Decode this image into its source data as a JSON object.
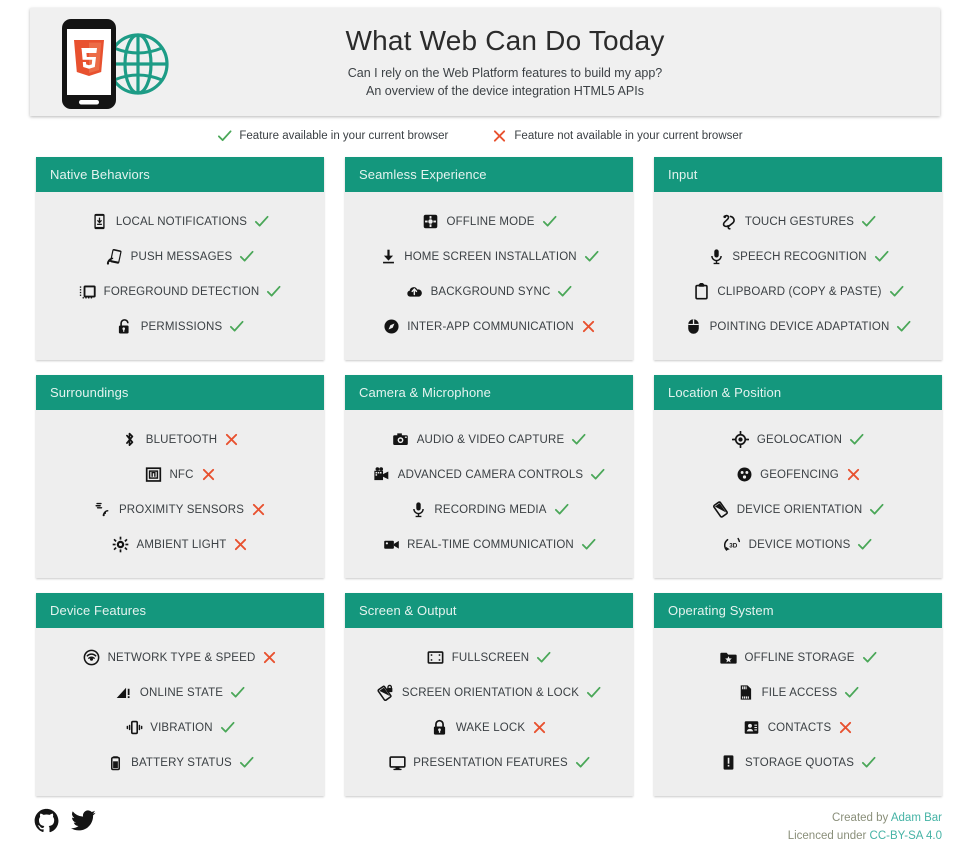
{
  "header": {
    "title": "What Web Can Do Today",
    "subtitle_line1": "Can I rely on the Web Platform features to build my app?",
    "subtitle_line2": "An overview of the device integration HTML5 APIs",
    "logo_icon": "html5-phone-globe-logo"
  },
  "legend": {
    "available_label": "Feature available in your current browser",
    "unavailable_label": "Feature not available in your current browser",
    "available_icon": "check-icon",
    "unavailable_icon": "cross-icon"
  },
  "colors": {
    "card_header_bg": "#14977d",
    "card_body_bg": "#eeeeee",
    "page_bg": "#ffffff",
    "check_green": "#4aa758",
    "cross_red": "#e8512f",
    "link_teal": "#45b3a5",
    "footer_text": "#8a8f7a"
  },
  "cards": [
    {
      "title": "Native Behaviors",
      "features": [
        {
          "label": "LOCAL NOTIFICATIONS",
          "icon": "phone-download-icon",
          "status": "available"
        },
        {
          "label": "PUSH MESSAGES",
          "icon": "phone-signal-icon",
          "status": "available"
        },
        {
          "label": "FOREGROUND DETECTION",
          "icon": "foreground-window-icon",
          "status": "available"
        },
        {
          "label": "PERMISSIONS",
          "icon": "padlock-open-icon",
          "status": "available"
        }
      ]
    },
    {
      "title": "Seamless Experience",
      "features": [
        {
          "label": "OFFLINE MODE",
          "icon": "offline-gear-icon",
          "status": "available"
        },
        {
          "label": "HOME SCREEN INSTALLATION",
          "icon": "download-arrow-icon",
          "status": "available"
        },
        {
          "label": "BACKGROUND SYNC",
          "icon": "cloud-upload-icon",
          "status": "available"
        },
        {
          "label": "INTER-APP COMMUNICATION",
          "icon": "compass-icon",
          "status": "unavailable"
        }
      ]
    },
    {
      "title": "Input",
      "features": [
        {
          "label": "TOUCH GESTURES",
          "icon": "touch-gesture-icon",
          "status": "available"
        },
        {
          "label": "SPEECH RECOGNITION",
          "icon": "microphone-icon",
          "status": "available"
        },
        {
          "label": "CLIPBOARD (COPY & PASTE)",
          "icon": "clipboard-icon",
          "status": "available"
        },
        {
          "label": "POINTING DEVICE ADAPTATION",
          "icon": "mouse-icon",
          "status": "available"
        }
      ]
    },
    {
      "title": "Surroundings",
      "features": [
        {
          "label": "BLUETOOTH",
          "icon": "bluetooth-icon",
          "status": "unavailable"
        },
        {
          "label": "NFC",
          "icon": "nfc-icon",
          "status": "unavailable"
        },
        {
          "label": "PROXIMITY SENSORS",
          "icon": "proximity-waves-icon",
          "status": "unavailable"
        },
        {
          "label": "AMBIENT LIGHT",
          "icon": "sun-brightness-icon",
          "status": "unavailable"
        }
      ]
    },
    {
      "title": "Camera & Microphone",
      "features": [
        {
          "label": "AUDIO & VIDEO CAPTURE",
          "icon": "camera-icon",
          "status": "available"
        },
        {
          "label": "ADVANCED CAMERA CONTROLS",
          "icon": "film-camera-icon",
          "status": "available"
        },
        {
          "label": "RECORDING MEDIA",
          "icon": "microphone-icon",
          "status": "available"
        },
        {
          "label": "REAL-TIME COMMUNICATION",
          "icon": "video-camera-icon",
          "status": "available"
        }
      ]
    },
    {
      "title": "Location & Position",
      "features": [
        {
          "label": "GEOLOCATION",
          "icon": "crosshair-target-icon",
          "status": "available"
        },
        {
          "label": "GEOFENCING",
          "icon": "geofence-circle-icon",
          "status": "unavailable"
        },
        {
          "label": "DEVICE ORIENTATION",
          "icon": "rotate-device-icon",
          "status": "available"
        },
        {
          "label": "DEVICE MOTIONS",
          "icon": "three-d-motion-icon",
          "status": "available"
        }
      ]
    },
    {
      "title": "Device Features",
      "features": [
        {
          "label": "NETWORK TYPE & SPEED",
          "icon": "network-signal-icon",
          "status": "unavailable"
        },
        {
          "label": "ONLINE STATE",
          "icon": "signal-bars-alert-icon",
          "status": "available"
        },
        {
          "label": "VIBRATION",
          "icon": "vibration-icon",
          "status": "available"
        },
        {
          "label": "BATTERY STATUS",
          "icon": "battery-icon",
          "status": "available"
        }
      ]
    },
    {
      "title": "Screen & Output",
      "features": [
        {
          "label": "FULLSCREEN",
          "icon": "fullscreen-icon",
          "status": "available"
        },
        {
          "label": "SCREEN ORIENTATION & LOCK",
          "icon": "screen-rotation-lock-icon",
          "status": "available"
        },
        {
          "label": "WAKE LOCK",
          "icon": "padlock-closed-icon",
          "status": "unavailable"
        },
        {
          "label": "PRESENTATION FEATURES",
          "icon": "monitor-icon",
          "status": "available"
        }
      ]
    },
    {
      "title": "Operating System",
      "features": [
        {
          "label": "OFFLINE STORAGE",
          "icon": "star-folder-icon",
          "status": "available"
        },
        {
          "label": "FILE ACCESS",
          "icon": "memory-card-icon",
          "status": "available"
        },
        {
          "label": "CONTACTS",
          "icon": "contact-card-icon",
          "status": "unavailable"
        },
        {
          "label": "STORAGE QUOTAS",
          "icon": "storage-alert-icon",
          "status": "available"
        }
      ]
    }
  ],
  "footer": {
    "github_icon": "github-icon",
    "twitter_icon": "twitter-icon",
    "created_prefix": "Created by ",
    "created_author": "Adam Bar",
    "licence_prefix": "Licenced under ",
    "licence_name": "CC-BY-SA 4.0"
  }
}
